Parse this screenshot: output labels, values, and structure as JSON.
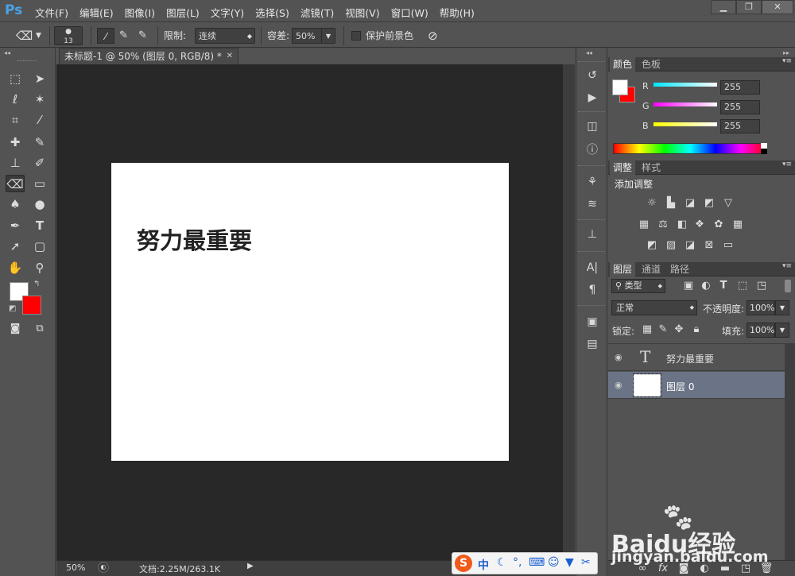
{
  "app": {
    "logo": "Ps"
  },
  "menu": [
    "文件(F)",
    "编辑(E)",
    "图像(I)",
    "图层(L)",
    "文字(Y)",
    "选择(S)",
    "滤镜(T)",
    "视图(V)",
    "窗口(W)",
    "帮助(H)"
  ],
  "window_controls": {
    "minimize": "▁",
    "restore": "❐",
    "close": "✕"
  },
  "options": {
    "brush_size": "13",
    "limit_label": "限制:",
    "limit_value": "连续",
    "tolerance_label": "容差:",
    "tolerance_value": "50%",
    "protect_fg_label": "保护前景色"
  },
  "document": {
    "tab_title": "未标题-1 @ 50% (图层 0, RGB/8) *",
    "canvas_text": "努力最重要",
    "zoom": "50%",
    "doc_info": "文档:2.25M/263.1K"
  },
  "colors": {
    "foreground": "#ffffff",
    "background": "#ff0000",
    "accent": "#4aa3e8"
  },
  "color_panel": {
    "tabs": [
      "颜色",
      "色板"
    ],
    "channels": [
      {
        "label": "R",
        "value": "255",
        "color": "#00e5ff"
      },
      {
        "label": "G",
        "value": "255",
        "color": "#ff00ff"
      },
      {
        "label": "B",
        "value": "255",
        "color": "#ffff00"
      }
    ]
  },
  "adjust_panel": {
    "tabs": [
      "调整",
      "样式"
    ],
    "heading": "添加调整"
  },
  "layers_panel": {
    "tabs": [
      "图层",
      "通道",
      "路径"
    ],
    "filter_label": "类型",
    "blend_mode": "正常",
    "opacity_label": "不透明度:",
    "opacity_value": "100%",
    "lock_label": "锁定:",
    "fill_label": "填充:",
    "fill_value": "100%",
    "layers": [
      {
        "name": "努力最重要",
        "type": "text",
        "selected": false
      },
      {
        "name": "图层 0",
        "type": "pixel",
        "selected": true
      }
    ]
  },
  "ime": {
    "label": "中"
  },
  "watermark": {
    "brand": "Baidu经验",
    "url": "jingyan.baidu.com"
  }
}
